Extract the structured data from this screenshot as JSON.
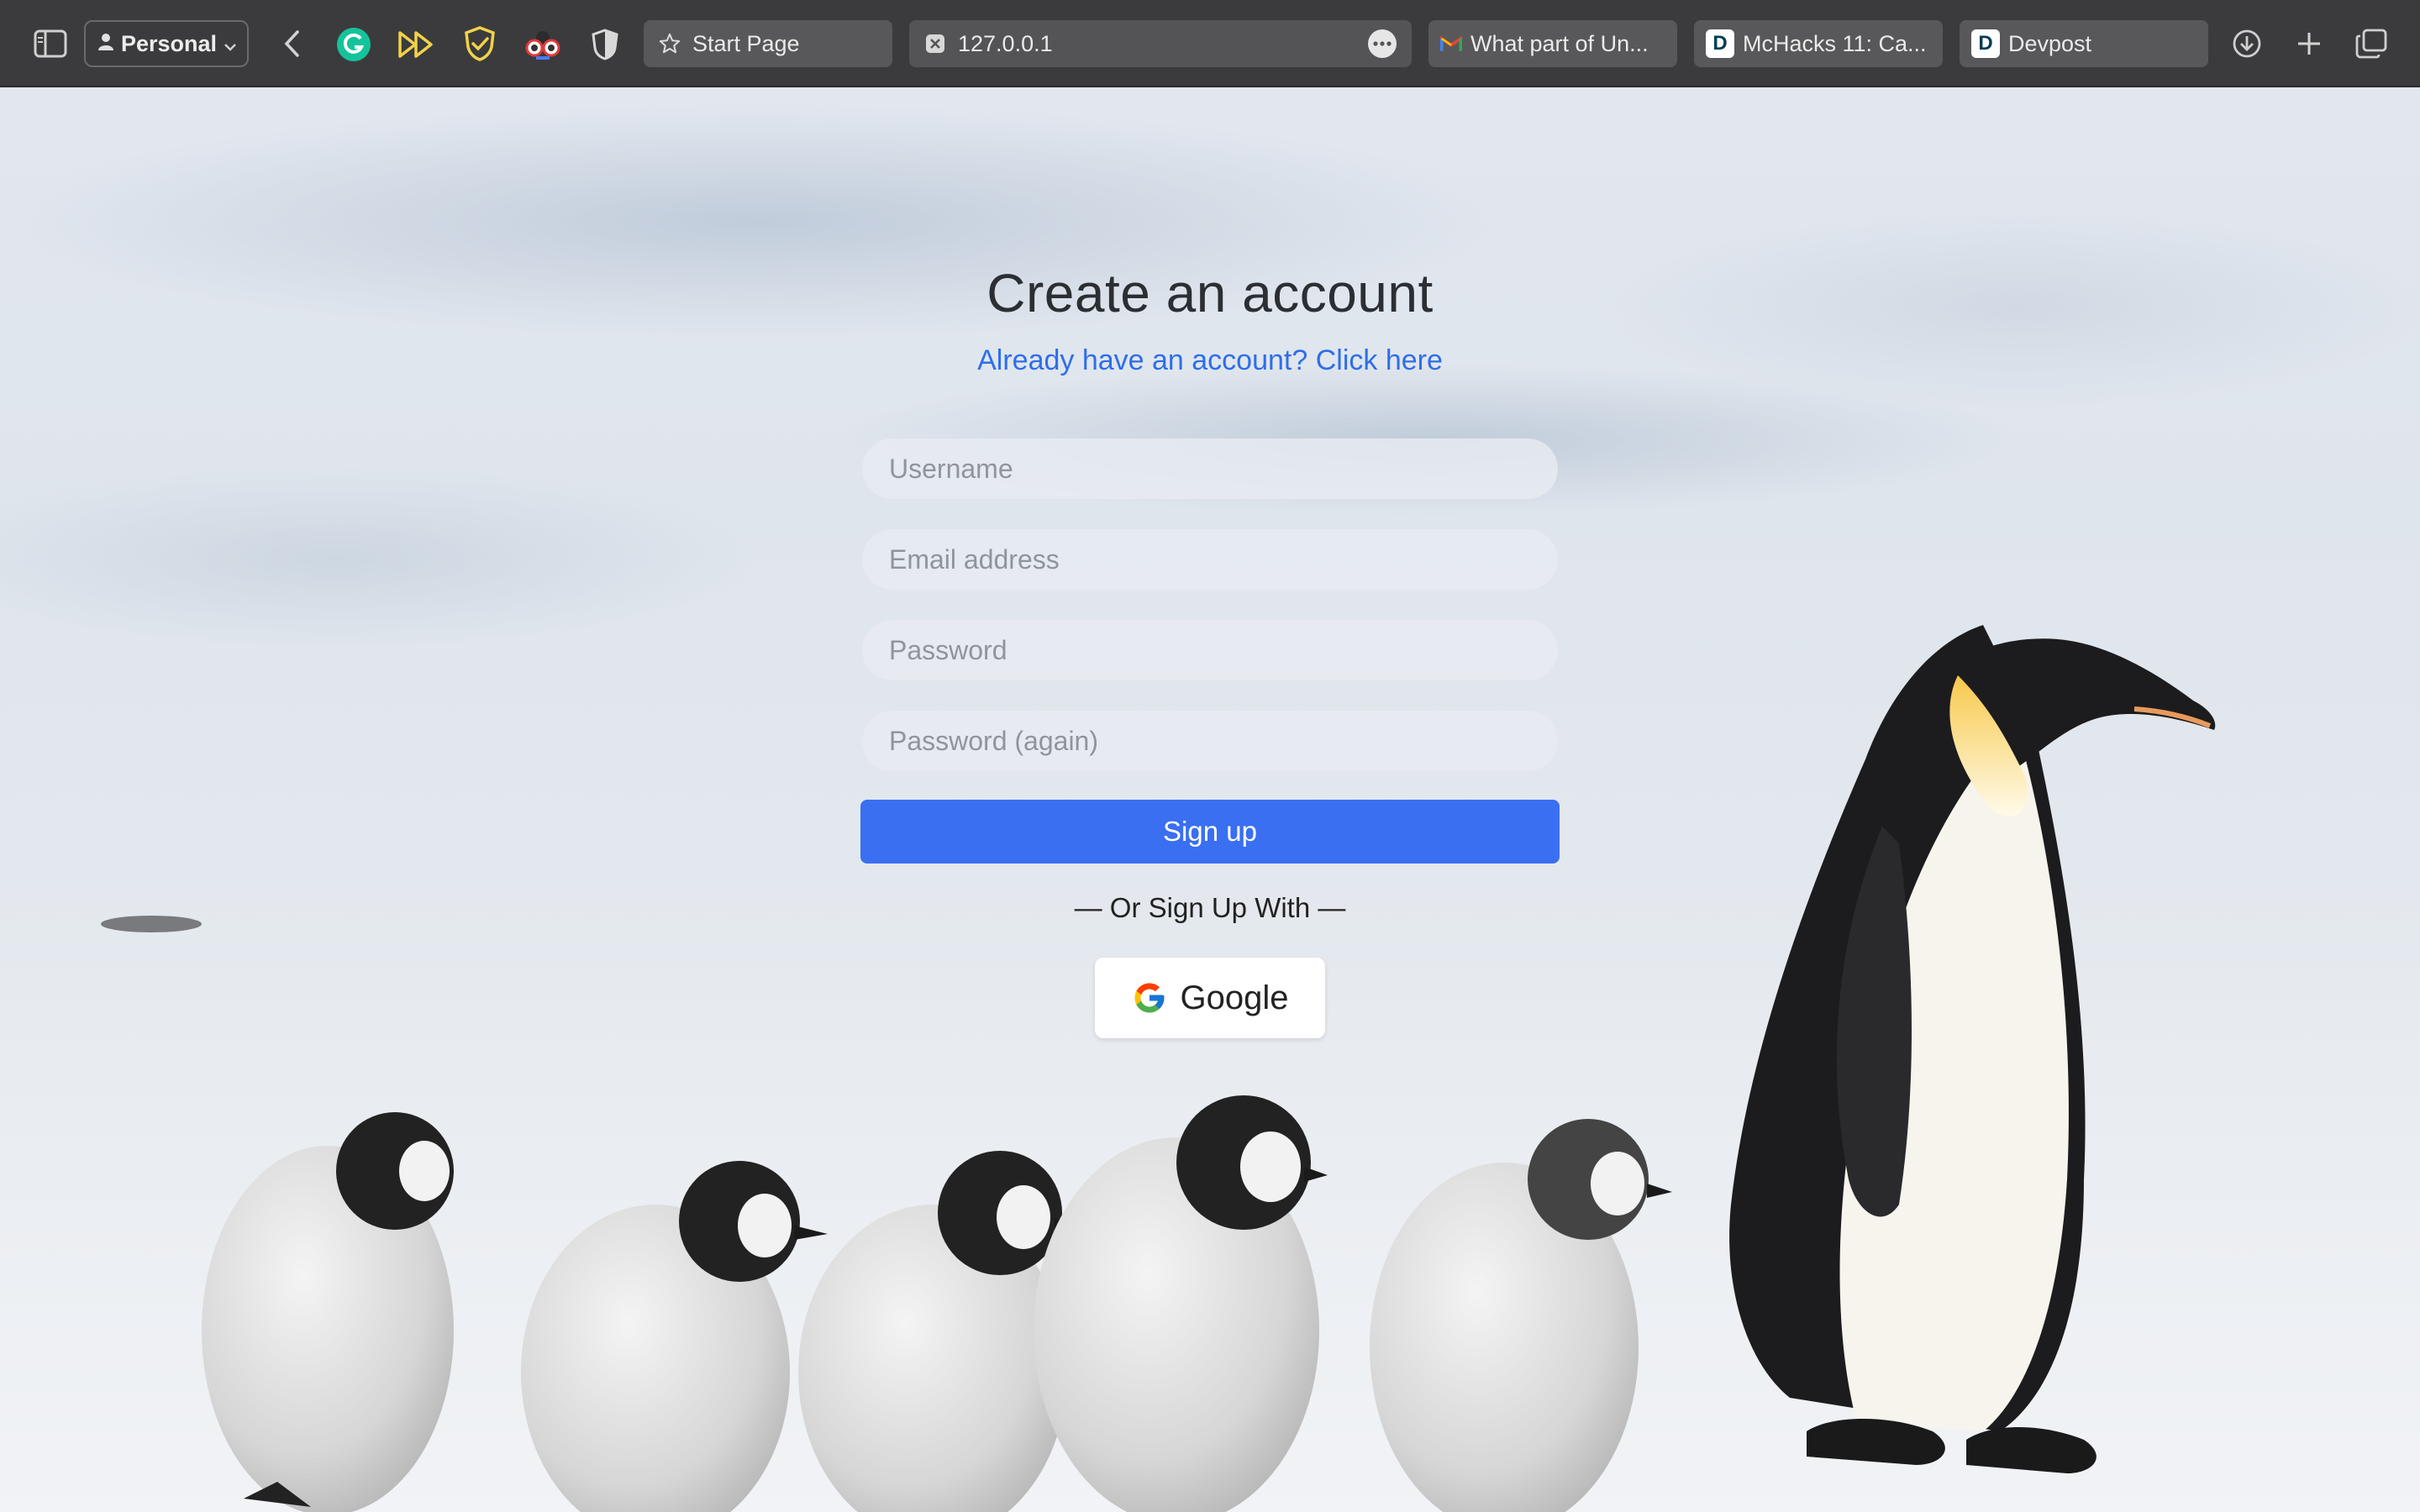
{
  "browser": {
    "profile_label": "Personal",
    "tabs": [
      {
        "label": "Start Page",
        "icon": "star-icon"
      },
      {
        "label": "127.0.0.1",
        "icon": "close-tab-icon",
        "active": true
      },
      {
        "label": "What part of Un...",
        "icon": "gmail-icon"
      },
      {
        "label": "McHacks 11: Ca...",
        "icon": "devpost-icon"
      },
      {
        "label": "Devpost",
        "icon": "devpost-icon"
      }
    ],
    "devpost_letter": "D",
    "toolbar_icons": [
      "sidebar-icon",
      "back-icon",
      "grammarly-icon",
      "fast-forward-icon",
      "shield-check-icon",
      "glasses-icon",
      "half-shield-icon",
      "download-icon",
      "new-tab-icon",
      "tab-overview-icon"
    ]
  },
  "form": {
    "title": "Create an account",
    "login_link": "Already have an account? Click here",
    "username_placeholder": "Username",
    "email_placeholder": "Email address",
    "password_placeholder": "Password",
    "password_again_placeholder": "Password (again)",
    "signup_label": "Sign up",
    "divider_text": "— Or Sign Up With —",
    "google_label": "Google"
  },
  "colors": {
    "primary": "#3a6ff2",
    "link": "#2e6ee8",
    "chrome": "#3b3b3d"
  }
}
